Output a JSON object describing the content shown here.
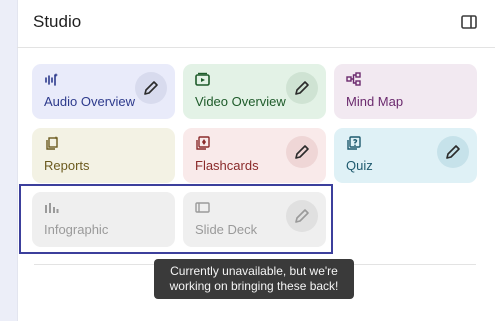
{
  "studio": {
    "title": "Studio",
    "panel_icon": "panel-toggle-icon"
  },
  "cards": [
    {
      "label": "Audio Overview",
      "icon": "audio-waveform-icon",
      "bg": "#e9ebfa",
      "color": "#2d3a8c",
      "has_edit": true
    },
    {
      "label": "Video Overview",
      "icon": "video-play-icon",
      "bg": "#e3f2e6",
      "color": "#1e5b2a",
      "has_edit": true
    },
    {
      "label": "Mind Map",
      "icon": "mind-map-icon",
      "bg": "#f2e9f1",
      "color": "#6b2a6e",
      "has_edit": false
    },
    {
      "label": "Reports",
      "icon": "reports-icon",
      "bg": "#f3f2e4",
      "color": "#6b5a1e",
      "has_edit": false
    },
    {
      "label": "Flashcards",
      "icon": "flashcards-icon",
      "bg": "#f9eaea",
      "color": "#8a2a2a",
      "has_edit": true
    },
    {
      "label": "Quiz",
      "icon": "quiz-icon",
      "bg": "#dff1f6",
      "color": "#1e5a6e",
      "has_edit": true
    },
    {
      "label": "Infographic",
      "icon": "infographic-icon",
      "bg": "#efefef",
      "color": "#9a9a9a",
      "has_edit": false
    },
    {
      "label": "Slide Deck",
      "icon": "slide-deck-icon",
      "bg": "#efefef",
      "color": "#9a9a9a",
      "has_edit": true
    }
  ],
  "tooltip": {
    "line1": "Currently unavailable, but we're",
    "line2": "working on bringing these back!"
  },
  "colors": {
    "highlight_border": "#3c3f9c",
    "tooltip_bg": "#3a3a3a"
  }
}
